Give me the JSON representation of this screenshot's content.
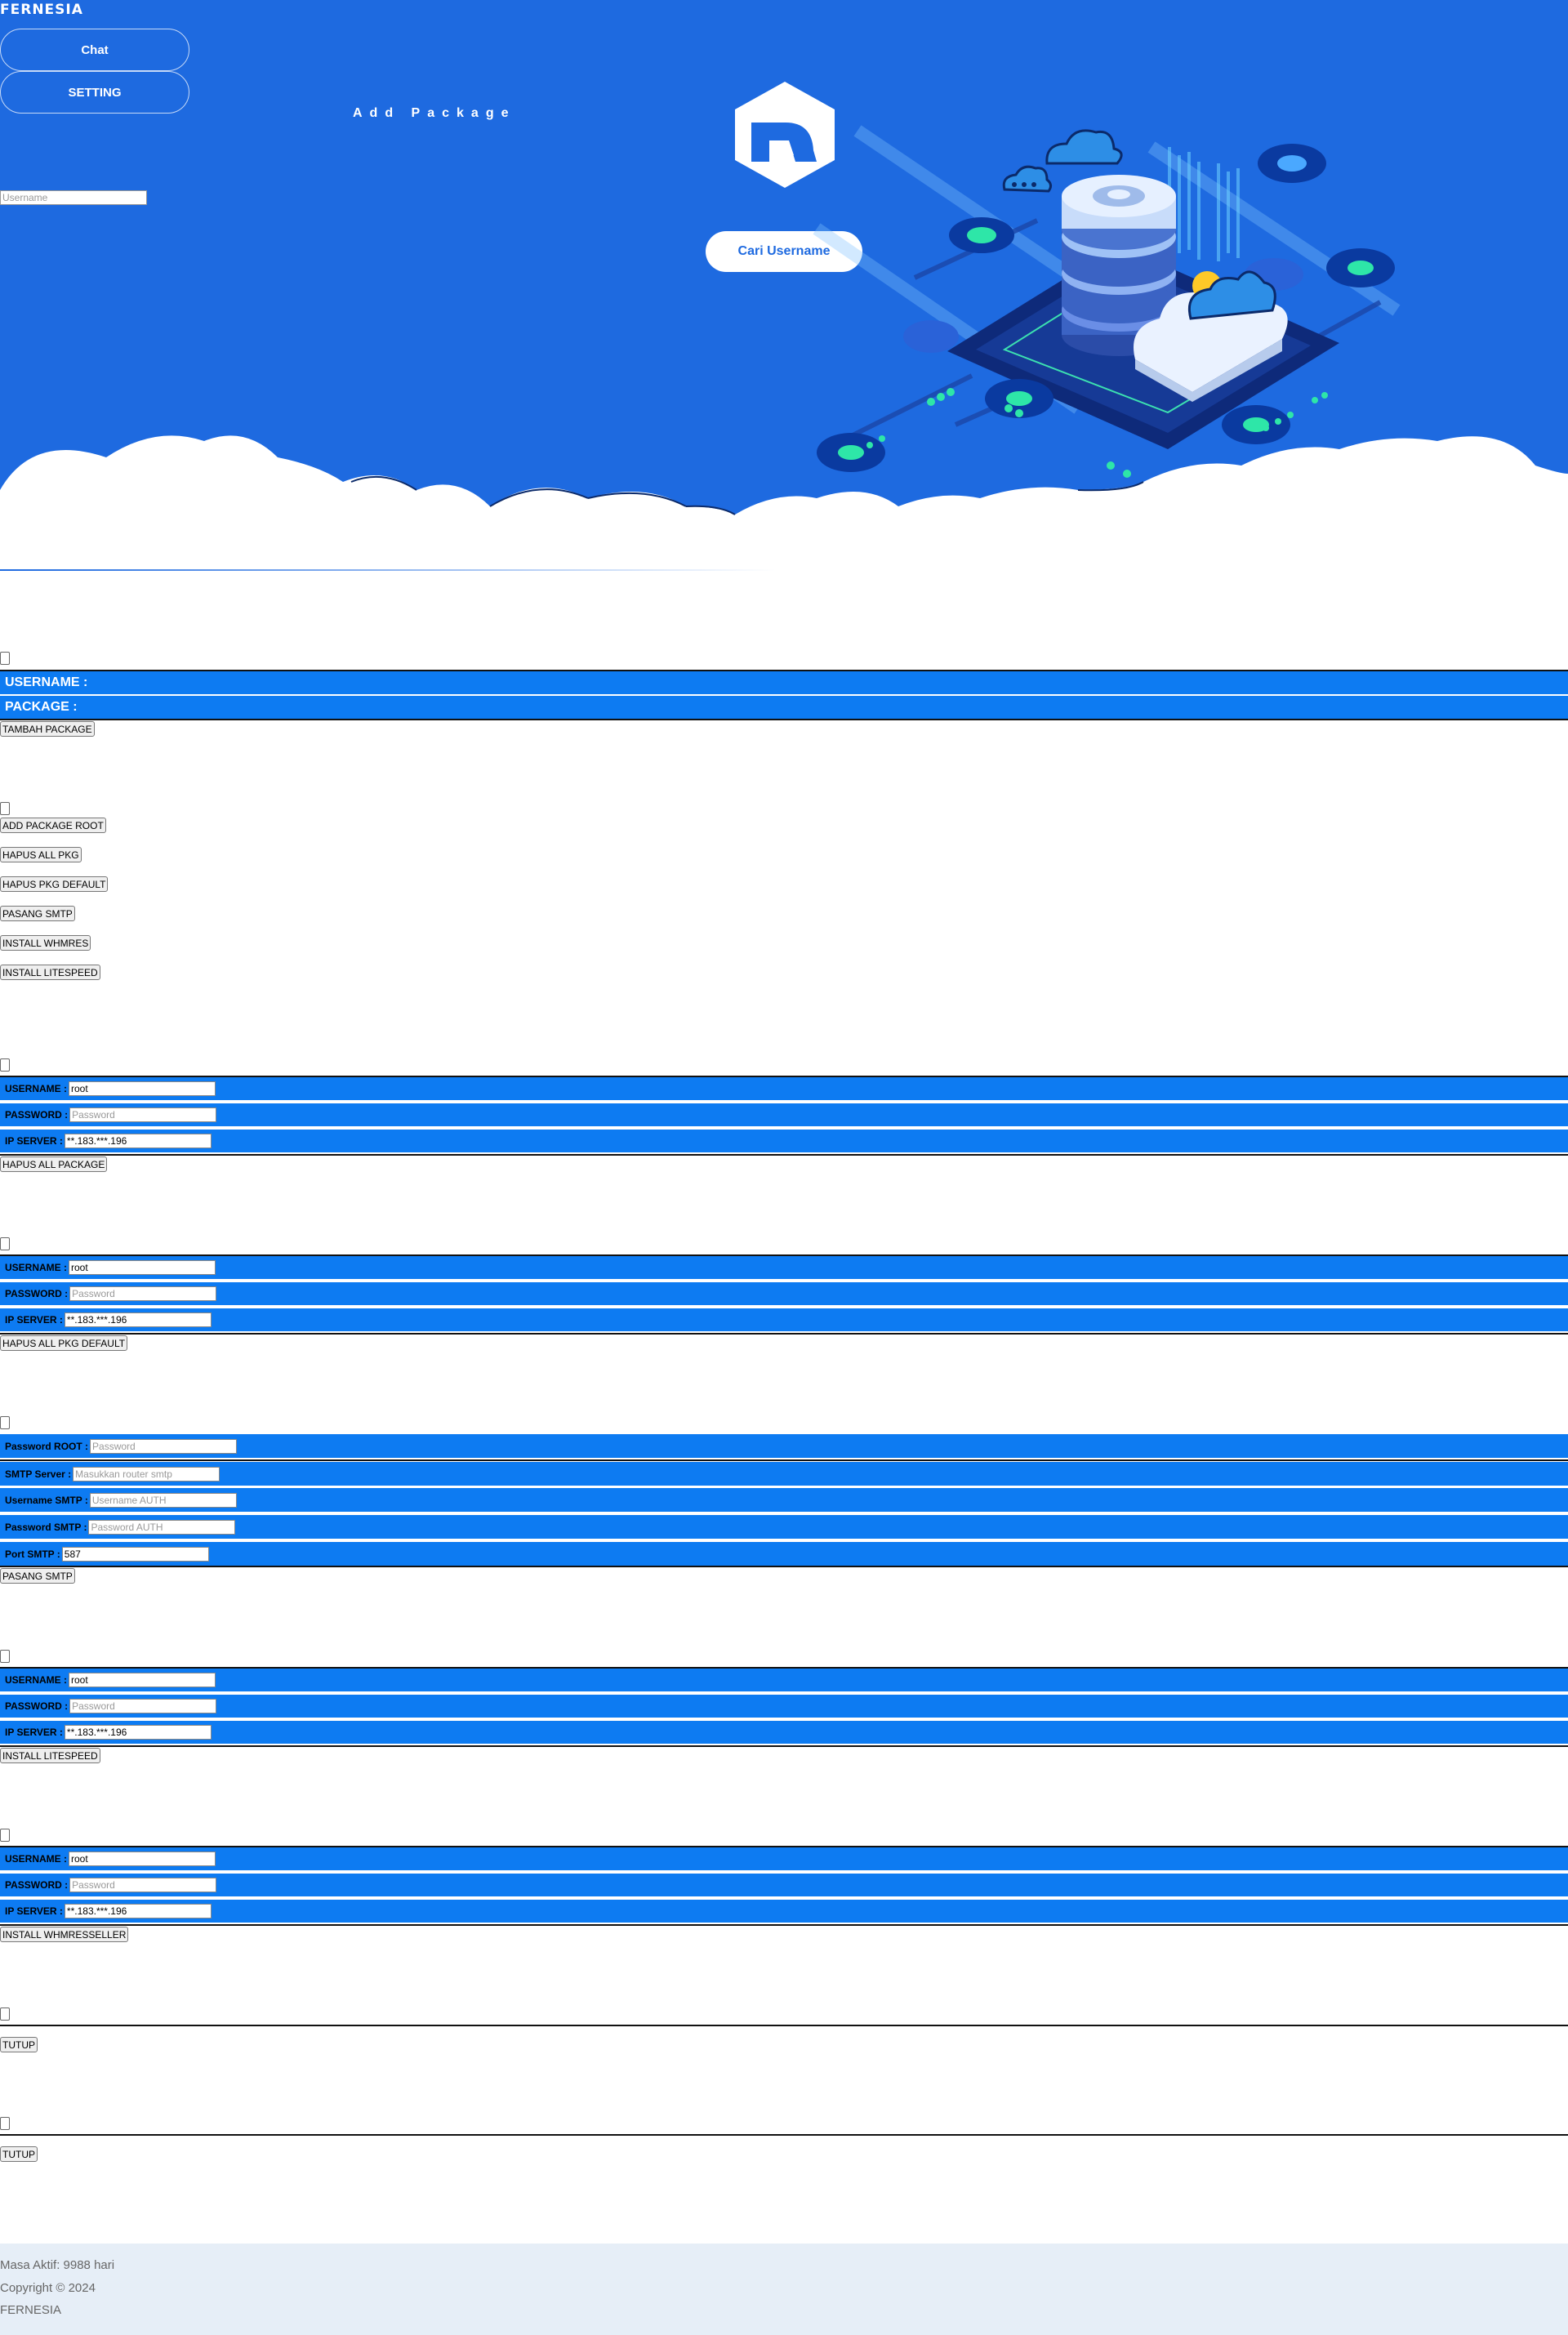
{
  "brand": "FERNESIA",
  "nav": {
    "chat": "Chat",
    "setting": "SETTING"
  },
  "hero": {
    "title": "Add Package",
    "search_placeholder": "Username",
    "search_button": "Cari Username"
  },
  "add_package": {
    "username_label": "USERNAME :",
    "package_label": "PACKAGE :",
    "submit": "TAMBAH PACKAGE"
  },
  "menu": [
    "ADD PACKAGE ROOT",
    "HAPUS ALL PKG",
    "HAPUS PKG DEFAULT",
    "PASANG SMTP",
    "INSTALL WHMRES",
    "INSTALL LITESPEED"
  ],
  "labels": {
    "username": "USERNAME :",
    "password": "PASSWORD :",
    "ip": "IP SERVER :"
  },
  "defaults": {
    "username": "root",
    "password_placeholder": "Password",
    "ip": "**.183.***.196"
  },
  "hapus_all": {
    "submit": "HAPUS ALL PACKAGE"
  },
  "hapus_default": {
    "submit": "HAPUS ALL PKG DEFAULT"
  },
  "smtp": {
    "root_label": "Password ROOT :",
    "root_placeholder": "Password",
    "server_label": "SMTP Server :",
    "server_placeholder": "Masukkan router smtp",
    "user_label": "Username SMTP :",
    "user_placeholder": "Username AUTH",
    "pass_label": "Password SMTP :",
    "pass_placeholder": "Password AUTH",
    "port_label": "Port SMTP :",
    "port_value": "587",
    "submit": "PASANG SMTP"
  },
  "litespeed": {
    "submit": "INSTALL LITESPEED"
  },
  "whmres": {
    "submit": "INSTALL WHMRESSELLER"
  },
  "close": {
    "label1": "TUTUP",
    "label2": "TUTUP"
  },
  "footer": {
    "masa": "Masa Aktif: 9988 hari",
    "copyright": "Copyright © 2024",
    "brand": "FERNESIA"
  },
  "colors": {
    "hero": "#1e6ae0",
    "bar": "#0d7bf2",
    "footer": "#e6eef7"
  }
}
